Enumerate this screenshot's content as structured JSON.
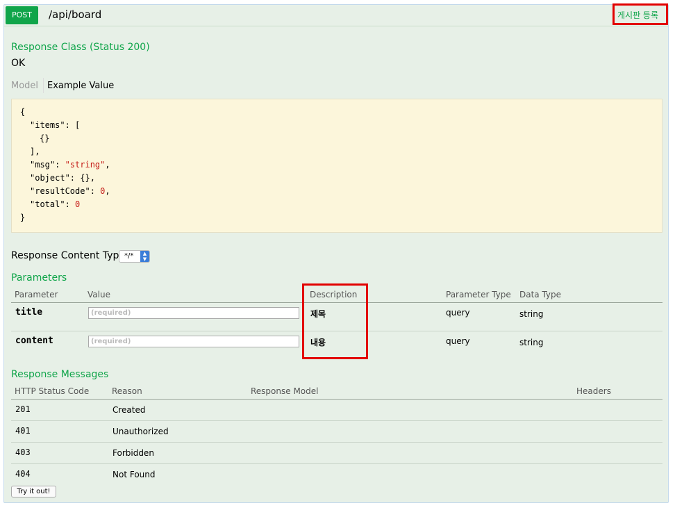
{
  "operation": {
    "method": "POST",
    "path": "/api/board",
    "summary": "게시판 등록"
  },
  "response_class": {
    "title": "Response Class (Status 200)",
    "status_text": "OK",
    "tabs": [
      "Model",
      "Example Value"
    ],
    "active_tab": "Example Value"
  },
  "example_value": {
    "lines": [
      {
        "indent": 0,
        "text": "{"
      },
      {
        "indent": 1,
        "key": "\"items\"",
        "rest": ": ["
      },
      {
        "indent": 2,
        "text": "{}"
      },
      {
        "indent": 1,
        "text": "],"
      },
      {
        "indent": 1,
        "key": "\"msg\"",
        "sep": ": ",
        "value": "\"string\"",
        "tail": ","
      },
      {
        "indent": 1,
        "key": "\"object\"",
        "rest": ": {},"
      },
      {
        "indent": 1,
        "key": "\"resultCode\"",
        "sep": ": ",
        "value": "0",
        "tail": ","
      },
      {
        "indent": 1,
        "key": "\"total\"",
        "sep": ": ",
        "value": "0",
        "tail": ""
      },
      {
        "indent": 0,
        "text": "}"
      }
    ]
  },
  "response_content_type": {
    "label": "Response Content Type",
    "selected": "*/*"
  },
  "parameters": {
    "title": "Parameters",
    "columns": [
      "Parameter",
      "Value",
      "Description",
      "Parameter Type",
      "Data Type"
    ],
    "rows": [
      {
        "name": "title",
        "placeholder": "(required)",
        "description": "제목",
        "param_type": "query",
        "data_type": "string"
      },
      {
        "name": "content",
        "placeholder": "(required)",
        "description": "내용",
        "param_type": "query",
        "data_type": "string"
      }
    ]
  },
  "response_messages": {
    "title": "Response Messages",
    "columns": [
      "HTTP Status Code",
      "Reason",
      "Response Model",
      "Headers"
    ],
    "rows": [
      {
        "code": "201",
        "reason": "Created"
      },
      {
        "code": "401",
        "reason": "Unauthorized"
      },
      {
        "code": "403",
        "reason": "Forbidden"
      },
      {
        "code": "404",
        "reason": "Not Found"
      }
    ]
  },
  "try_button": "Try it out!",
  "colors": {
    "accent_green": "#10a54a",
    "highlight_red": "#e20000",
    "panel_bg": "#e7f0e7",
    "code_bg": "#fcf6db"
  }
}
